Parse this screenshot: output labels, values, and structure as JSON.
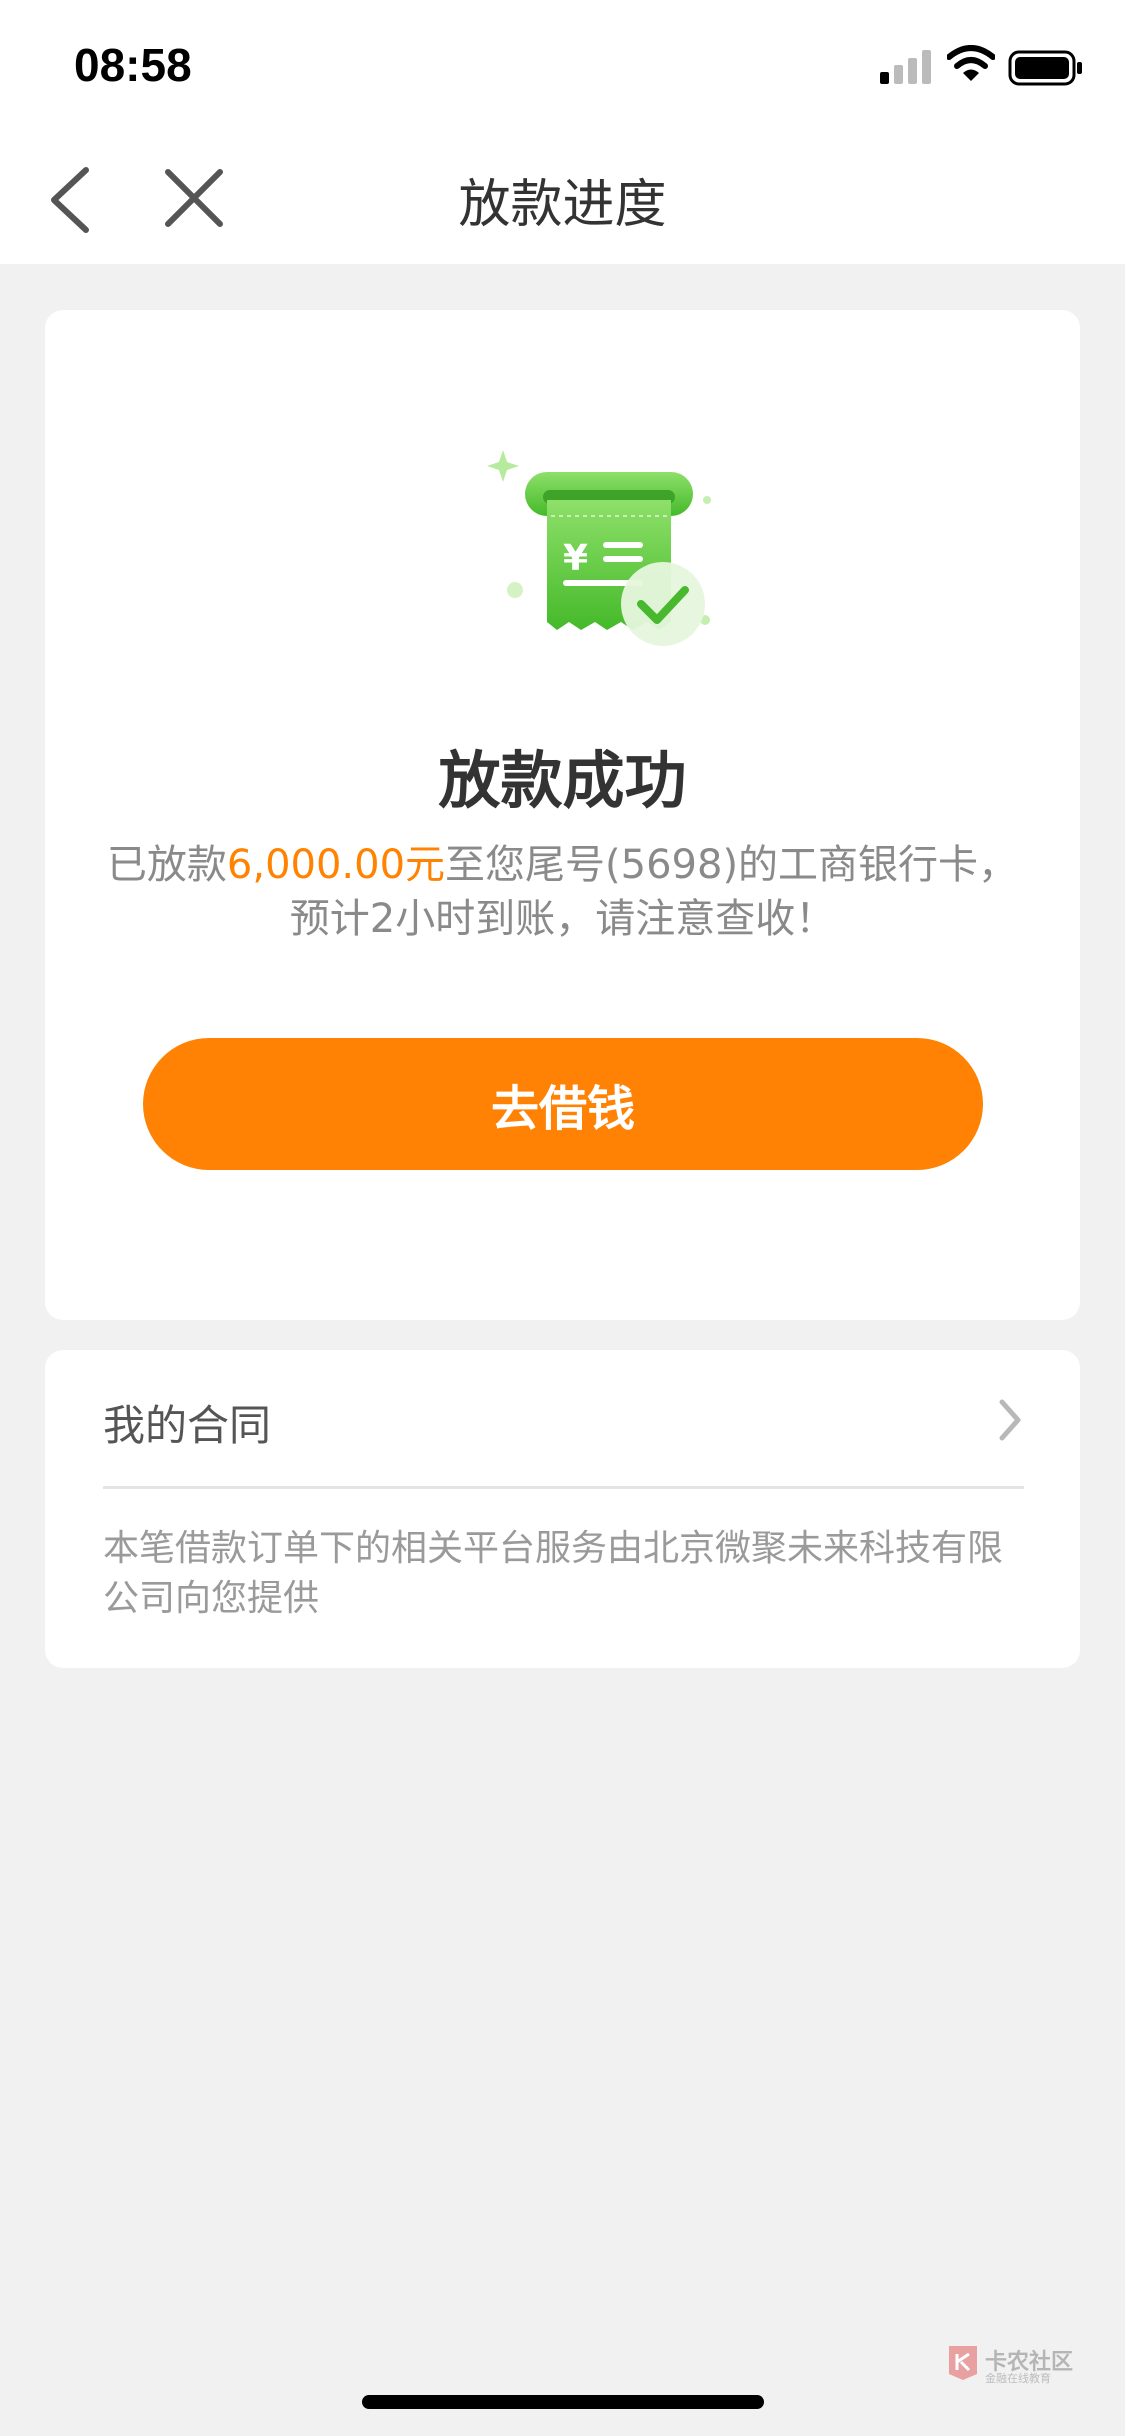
{
  "status_bar": {
    "time": "08:58",
    "icons": [
      "signal-icon",
      "wifi-icon",
      "battery-icon"
    ]
  },
  "nav": {
    "title": "放款进度",
    "back_icon": "chevron-left-icon",
    "close_icon": "close-icon"
  },
  "result": {
    "illustration_icon": "receipt-check-icon",
    "title": "放款成功",
    "desc_prefix": "已放款",
    "amount": "6,000.00元",
    "desc_suffix": "至您尾号(5698)的工商银行卡，",
    "desc_line2": "预计2小时到账，请注意查收！",
    "button_label": "去借钱"
  },
  "contract": {
    "label": "我的合同",
    "note": "本笔借款订单下的相关平台服务由北京微聚未来科技有限公司向您提供"
  },
  "watermark": {
    "text": "卡农社区",
    "sub": "金融在线教育"
  },
  "colors": {
    "accent": "#ff8205",
    "amount": "#ff8200",
    "success_green": "#5fcb3a",
    "background": "#f1f1f1"
  }
}
